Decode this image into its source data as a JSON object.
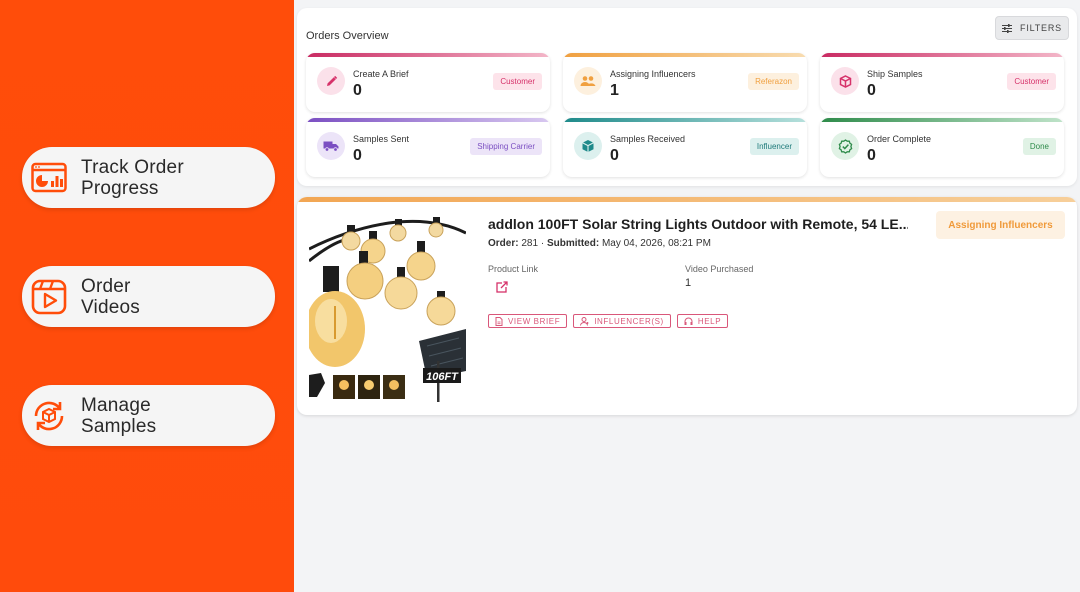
{
  "promo": {
    "items": [
      {
        "label": "Track Order Progress",
        "line1": "Track Order",
        "line2": "Progress",
        "icon": "dashboard-chart-icon"
      },
      {
        "label": "Order Videos",
        "line1": "Order",
        "line2": "Videos",
        "icon": "video-play-icon"
      },
      {
        "label": "Manage Samples",
        "line1": "Manage",
        "line2": "Samples",
        "icon": "refresh-box-icon"
      }
    ],
    "accent": "#ff4d0a"
  },
  "overview": {
    "title": "Orders Overview",
    "filters_label": "FILTERS",
    "stats": [
      {
        "label": "Create A Brief",
        "count": "0",
        "badge": "Customer",
        "icon": "pencil-icon",
        "color": "#d6326a"
      },
      {
        "label": "Assigning Influencers",
        "count": "1",
        "badge": "Referazon",
        "icon": "people-icon",
        "color": "#f0a040"
      },
      {
        "label": "Ship Samples",
        "count": "0",
        "badge": "Customer",
        "icon": "box-icon",
        "color": "#d6326a"
      },
      {
        "label": "Samples Sent",
        "count": "0",
        "badge": "Shipping Carrier",
        "icon": "truck-icon",
        "color": "#7b4fc2"
      },
      {
        "label": "Samples Received",
        "count": "0",
        "badge": "Influencer",
        "icon": "package-icon",
        "color": "#1e8a8a"
      },
      {
        "label": "Order Complete",
        "count": "0",
        "badge": "Done",
        "icon": "check-circle-icon",
        "color": "#2e8b4a"
      }
    ]
  },
  "order": {
    "title": "addlon 100FT Solar String Lights Outdoor with Remote, 54 LE...",
    "order_label": "Order:",
    "order_number": "281",
    "separator": "·",
    "submitted_label": "Submitted:",
    "submitted_date": "May 04, 2026, 08:21 PM",
    "product_link_label": "Product Link",
    "video_purchased_label": "Video Purchased",
    "video_purchased_value": "1",
    "status": "Assigning Influencers",
    "image_badge": "106FT",
    "actions": [
      {
        "label": "VIEW BRIEF",
        "icon": "document-icon"
      },
      {
        "label": "INFLUENCER(S)",
        "icon": "person-icon"
      },
      {
        "label": "HELP",
        "icon": "headset-icon"
      }
    ]
  }
}
